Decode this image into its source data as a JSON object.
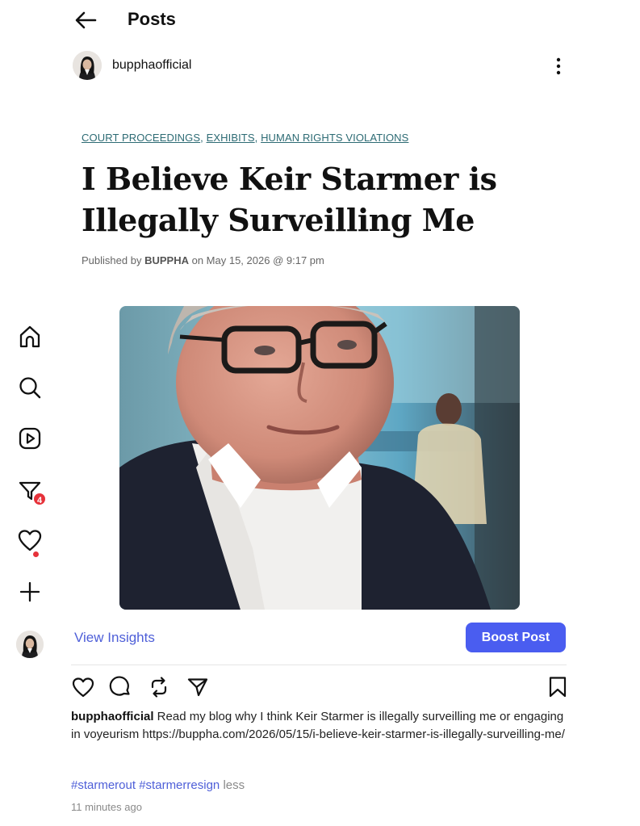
{
  "header": {
    "title": "Posts",
    "back_icon": "arrow-left-icon"
  },
  "post": {
    "username": "bupphaofficial",
    "more_icon": "vertical-dots-icon",
    "article": {
      "categories": [
        "COURT PROCEEDINGS",
        "EXHIBITS",
        "HUMAN RIGHTS VIOLATIONS"
      ],
      "title_line1": "I Believe Keir Starmer is",
      "title_line2": "Illegally Surveilling Me",
      "published_prefix": "Published by",
      "author": "BUPPHA",
      "published_on": "on May 15, 2026 @ 9:17 pm"
    },
    "image": {
      "description_icon": "photo-icon"
    },
    "insights_label": "View Insights",
    "boost_label": "Boost Post",
    "caption_user": "bupphaofficial",
    "caption_text": "Read my blog why I think Keir Starmer is illegally surveilling me or engaging in voyeurism https://buppha.com/2026/05/15/i-believe-keir-starmer-is-illegally-surveilling-me/",
    "hashtags": [
      "#starmerout",
      "#starmerresign"
    ],
    "less_label": "less",
    "time_ago": "11 minutes ago"
  },
  "sidebar": {
    "items": [
      {
        "icon": "home-icon"
      },
      {
        "icon": "search-icon"
      },
      {
        "icon": "reels-icon"
      },
      {
        "icon": "filter-icon",
        "badge": "4"
      },
      {
        "icon": "heart-icon"
      },
      {
        "icon": "plus-icon"
      },
      {
        "icon": "profile-avatar"
      }
    ]
  },
  "actions": [
    "like-icon",
    "comment-icon",
    "repost-icon",
    "share-icon",
    "bookmark-icon"
  ],
  "colors": {
    "accent": "#4a5df0",
    "link": "#4e5fd8",
    "category": "#2d6b74",
    "badge": "#e6323a"
  }
}
